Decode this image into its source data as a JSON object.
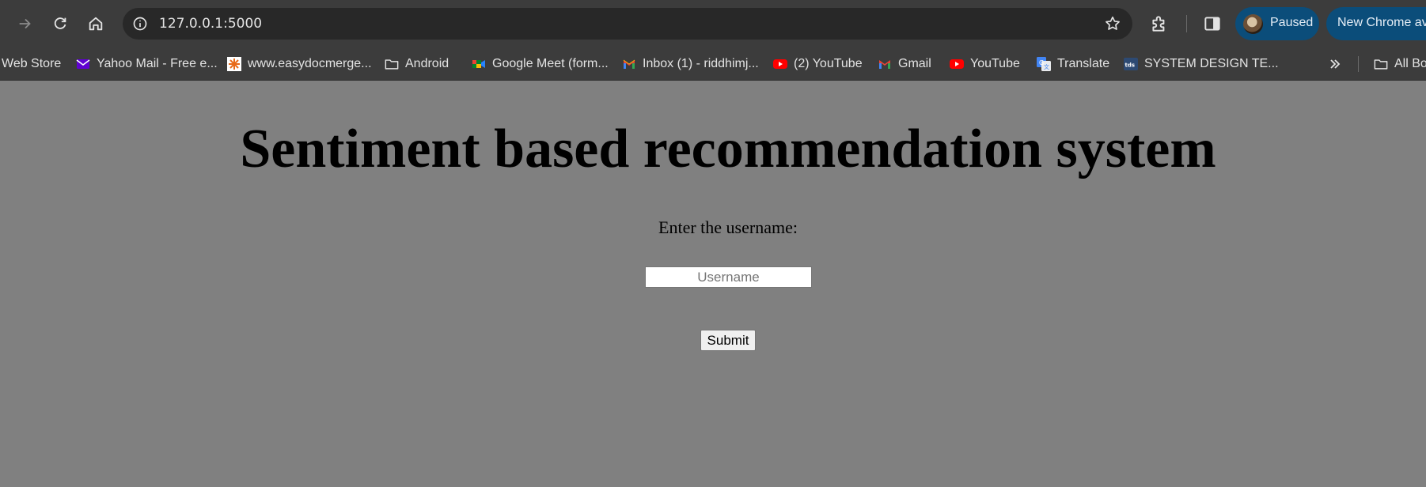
{
  "browser": {
    "url": "127.0.0.1:5000",
    "profile_status": "Paused",
    "update_label": "New Chrome available",
    "colors": {
      "chrome_bg": "#3c3c3c",
      "omnibox_bg": "#282828",
      "pill_bg": "#0b4d7a",
      "page_bg": "#808080"
    }
  },
  "bookmarks": [
    {
      "label": "Web Store",
      "icon": "web-store-icon"
    },
    {
      "label": "Yahoo Mail - Free e...",
      "icon": "yahoo-mail-icon"
    },
    {
      "label": "www.easydocmerge...",
      "icon": "easydocmerge-icon"
    },
    {
      "label": "Android",
      "icon": "folder-icon"
    },
    {
      "label": "Google Meet (form...",
      "icon": "google-meet-icon"
    },
    {
      "label": "Inbox (1) - riddhimj...",
      "icon": "gmail-icon"
    },
    {
      "label": "(2) YouTube",
      "icon": "youtube-icon"
    },
    {
      "label": "Gmail",
      "icon": "gmail-icon"
    },
    {
      "label": "YouTube",
      "icon": "youtube-icon"
    },
    {
      "label": "Translate",
      "icon": "google-translate-icon"
    },
    {
      "label": "SYSTEM DESIGN TE...",
      "icon": "tds-icon"
    },
    {
      "label": "All Bookmarks",
      "icon": "folder-icon"
    }
  ],
  "page": {
    "title": "Sentiment based recommendation system",
    "prompt": "Enter the username:",
    "username_placeholder": "Username",
    "username_value": "",
    "submit_label": "Submit"
  }
}
